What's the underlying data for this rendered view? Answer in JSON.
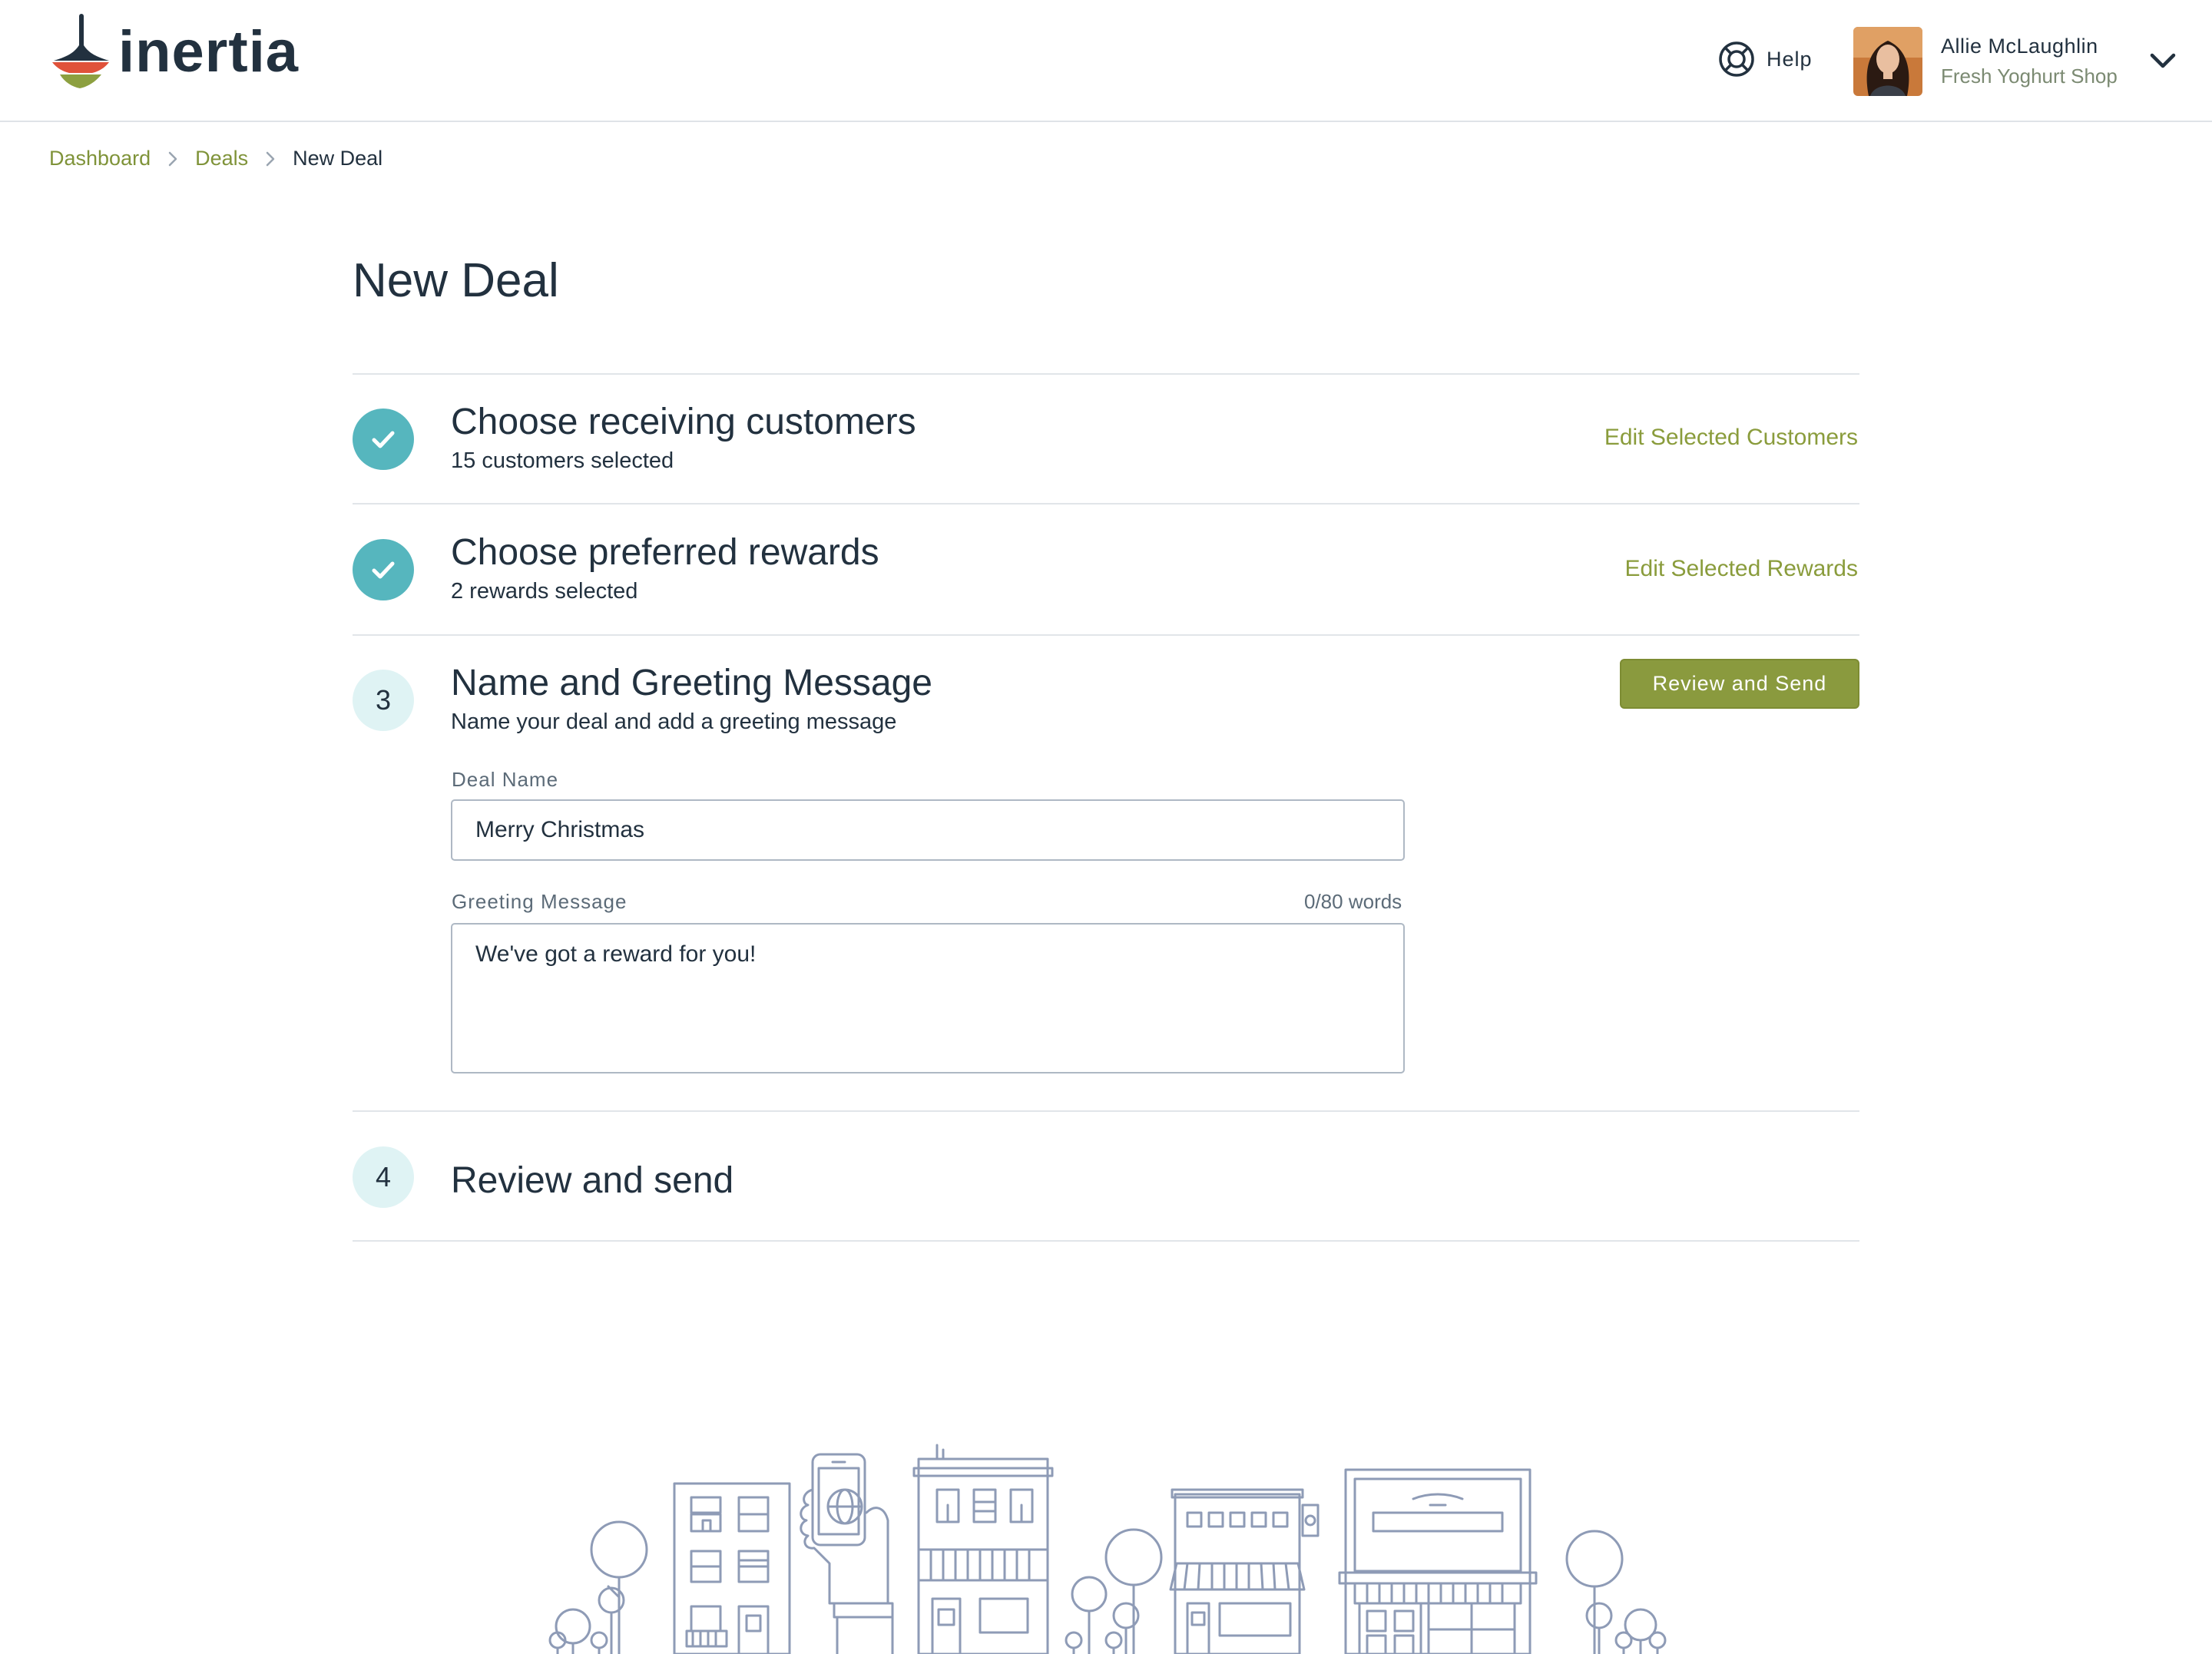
{
  "header": {
    "logo_text": "inertia",
    "help_label": "Help",
    "user": {
      "name": "Allie McLaughlin",
      "shop": "Fresh Yoghurt Shop"
    }
  },
  "breadcrumb": {
    "items": [
      "Dashboard",
      "Deals"
    ],
    "current": "New Deal"
  },
  "page": {
    "title": "New Deal"
  },
  "steps": [
    {
      "status": "complete",
      "title": "Choose receiving customers",
      "subtitle": "15 customers selected",
      "action": "Edit Selected Customers"
    },
    {
      "status": "complete",
      "title": "Choose preferred rewards",
      "subtitle": "2 rewards selected",
      "action": "Edit Selected Rewards"
    },
    {
      "status": "active",
      "number": "3",
      "title": "Name and Greeting Message",
      "subtitle": "Name your deal and add a greeting message",
      "action": "Review and Send",
      "form": {
        "deal_name_label": "Deal Name",
        "deal_name_value": "Merry Christmas",
        "greeting_label": "Greeting Message",
        "greeting_count": "0/80 words",
        "greeting_value": "We've got a reward for you!"
      }
    },
    {
      "status": "pending",
      "number": "4",
      "title": "Review and send"
    }
  ],
  "colors": {
    "accent_green": "#8a9a3e",
    "link_green": "#7f9339",
    "step_done_teal": "#56b6be",
    "step_pending_bg": "#dff3f4",
    "text_dark": "#22313f"
  },
  "icons": {
    "logo": "spinning-top-icon",
    "help": "lifebuoy-icon",
    "breadcrumb_separator": "chevron-right-icon",
    "user_menu": "chevron-down-icon",
    "step_complete": "checkmark-icon"
  }
}
